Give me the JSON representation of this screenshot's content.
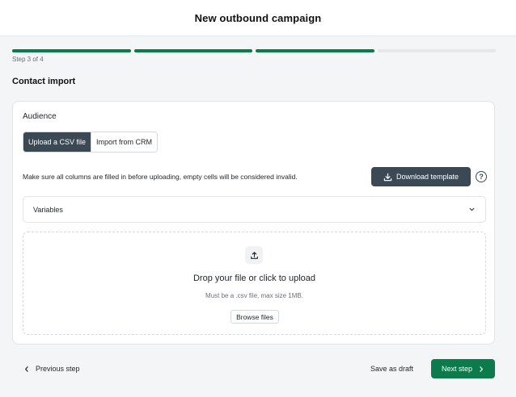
{
  "header": {
    "title": "New outbound campaign"
  },
  "progress": {
    "current_step": 3,
    "total_steps": 4,
    "label": "Step 3 of 4"
  },
  "section": {
    "title": "Contact import"
  },
  "audience": {
    "label": "Audience",
    "options": [
      "Upload a CSV file",
      "Import from CRM"
    ],
    "selected": "Upload a CSV file"
  },
  "hint": "Make sure all columns are filled in before uploading, empty cells will be considered invalid.",
  "download_button": "Download template",
  "help_icon": "?",
  "variables": {
    "label": "Variables"
  },
  "dropzone": {
    "title": "Drop your file or click to upload",
    "subtitle": "Must be a .csv file, max size 1MB.",
    "browse_label": "Browse files"
  },
  "footer": {
    "previous_label": "Previous step",
    "draft_label": "Save as draft",
    "next_label": "Next step"
  },
  "icons": {
    "download": "download-icon",
    "help": "help-icon",
    "chevron": "chevron-down-icon",
    "upload": "upload-icon",
    "prev": "chevron-left-icon",
    "next": "chevron-right-icon"
  },
  "colors": {
    "accent": "#0d7a4c",
    "dark": "#3a4954",
    "track": "#e6e8eb"
  }
}
